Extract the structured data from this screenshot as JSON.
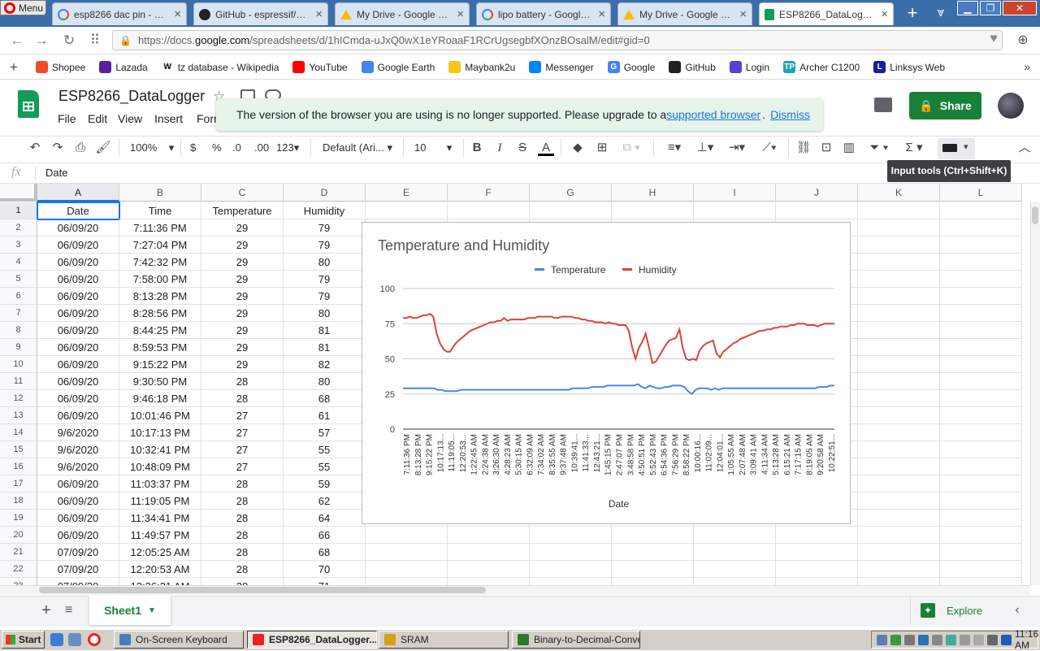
{
  "browser": {
    "menu_label": "Menu",
    "tabs": [
      {
        "title": "esp8266 dac pin - Google",
        "icon": "google-icon",
        "active": false
      },
      {
        "title": "GitHub - espressif/ESP82",
        "icon": "github-icon",
        "active": false
      },
      {
        "title": "My Drive - Google Drive",
        "icon": "drive-icon",
        "active": false
      },
      {
        "title": "lipo battery - Google Sea",
        "icon": "google-icon",
        "active": false
      },
      {
        "title": "My Drive - Google Drive",
        "icon": "drive-icon",
        "active": false
      },
      {
        "title": "ESP8266_DataLogger - G",
        "icon": "sheets-icon",
        "active": true
      }
    ],
    "url_prefix": "https://docs.",
    "url_host": "google.com",
    "url_path": "/spreadsheets/d/1hICmda-uJxQ0wX1eYRoaaF1RCrUgsegbfXOnzBOsalM/edit#gid=0",
    "bookmarks": [
      {
        "label": "Shopee",
        "color": "#ee4d2d"
      },
      {
        "label": "Lazada",
        "color": "#5a1f9e"
      },
      {
        "label": "tz database - Wikipedia",
        "color": "#ffffff",
        "glyph": "W"
      },
      {
        "label": "YouTube",
        "color": "#ff0000"
      },
      {
        "label": "Google Earth",
        "color": "#4285f4"
      },
      {
        "label": "Maybank2u",
        "color": "#f5c518"
      },
      {
        "label": "Messenger",
        "color": "#0084ff"
      },
      {
        "label": "Google",
        "color": "#4285f4",
        "glyph": "G"
      },
      {
        "label": "GitHub",
        "color": "#222222"
      },
      {
        "label": "Login",
        "color": "#5b3fd1"
      },
      {
        "label": "Archer C1200",
        "color": "#1aa3b8",
        "glyph": "TP"
      },
      {
        "label": "Linksys Web",
        "color": "#1a1aa8",
        "glyph": "L"
      }
    ]
  },
  "doc": {
    "title": "ESP8266_DataLogger",
    "menus": [
      "File",
      "Edit",
      "View",
      "Insert",
      "Forr"
    ],
    "banner_text": "The version of the browser you are using is no longer supported. Please upgrade to a",
    "banner_link": "supported browser",
    "banner_period": ".",
    "banner_dismiss": "Dismiss",
    "share_label": "Share"
  },
  "toolbar": {
    "zoom": "100%",
    "currency": "$",
    "percent": "%",
    "dec_less": ".0",
    "dec_more": ".00",
    "more_formats": "123",
    "font": "Default (Ari...",
    "font_size": "10",
    "bold": "B",
    "italic": "I",
    "strike": "S",
    "text_color": "A",
    "tooltip": "Input tools (Ctrl+Shift+K)"
  },
  "formula": {
    "fx": "fx",
    "value": "Date"
  },
  "grid": {
    "columns": [
      "A",
      "B",
      "C",
      "D",
      "E",
      "F",
      "G",
      "H",
      "I",
      "J",
      "K",
      "L"
    ],
    "row_numbers": [
      "1",
      "2",
      "3",
      "4",
      "5",
      "6",
      "7",
      "8",
      "9",
      "10",
      "11",
      "12",
      "13",
      "14",
      "15",
      "16",
      "17",
      "18",
      "19",
      "20",
      "21",
      "22",
      "23"
    ],
    "rows": [
      [
        "Date",
        "Time",
        "Temperature",
        "Humidity"
      ],
      [
        "06/09/20",
        "7:11:36 PM",
        "29",
        "79"
      ],
      [
        "06/09/20",
        "7:27:04 PM",
        "29",
        "79"
      ],
      [
        "06/09/20",
        "7:42:32 PM",
        "29",
        "80"
      ],
      [
        "06/09/20",
        "7:58:00 PM",
        "29",
        "79"
      ],
      [
        "06/09/20",
        "8:13:28 PM",
        "29",
        "79"
      ],
      [
        "06/09/20",
        "8:28:56 PM",
        "29",
        "80"
      ],
      [
        "06/09/20",
        "8:44:25 PM",
        "29",
        "81"
      ],
      [
        "06/09/20",
        "8:59:53 PM",
        "29",
        "81"
      ],
      [
        "06/09/20",
        "9:15:22 PM",
        "29",
        "82"
      ],
      [
        "06/09/20",
        "9:30:50 PM",
        "28",
        "80"
      ],
      [
        "06/09/20",
        "9:46:18 PM",
        "28",
        "68"
      ],
      [
        "06/09/20",
        "10:01:46 PM",
        "27",
        "61"
      ],
      [
        "9/6/2020",
        "10:17:13 PM",
        "27",
        "57"
      ],
      [
        "9/6/2020",
        "10:32:41 PM",
        "27",
        "55"
      ],
      [
        "9/6/2020",
        "10:48:09 PM",
        "27",
        "55"
      ],
      [
        "06/09/20",
        "11:03:37 PM",
        "28",
        "59"
      ],
      [
        "06/09/20",
        "11:19:05 PM",
        "28",
        "62"
      ],
      [
        "06/09/20",
        "11:34:41 PM",
        "28",
        "64"
      ],
      [
        "06/09/20",
        "11:49:57 PM",
        "28",
        "66"
      ],
      [
        "07/09/20",
        "12:05:25 AM",
        "28",
        "68"
      ],
      [
        "07/09/20",
        "12:20:53 AM",
        "28",
        "70"
      ],
      [
        "07/09/20",
        "12:36:21 AM",
        "28",
        "71"
      ]
    ]
  },
  "chart_data": {
    "type": "line",
    "title": "Temperature and Humidity",
    "xlabel": "Date",
    "ylabel": "",
    "ylim": [
      0,
      100
    ],
    "yticks": [
      "100",
      "75",
      "50",
      "25",
      "0"
    ],
    "legend_position": "top",
    "grid": true,
    "x_tick_labels": [
      "7:11:36 PM",
      "8:13:28 PM",
      "9:15:22 PM",
      "10:17:13...",
      "11:19:05...",
      "12:20:53...",
      "1:22:45 AM",
      "2:24:38 AM",
      "3:26:30 AM",
      "4:28:23 AM",
      "5:30:15 AM",
      "6:32:09 AM",
      "7:34:02 AM",
      "8:35:55 AM",
      "9:37:48 AM",
      "10:39:41...",
      "11:41:33...",
      "12:43:21...",
      "1:45:15 PM",
      "2:47:07 PM",
      "3:48:58 PM",
      "4:50:51 PM",
      "5:52:43 PM",
      "6:54:36 PM",
      "7:56:29 PM",
      "8:58:22 PM",
      "10:00:16...",
      "11:02:09...",
      "12:04:01...",
      "1:05:55 AM",
      "2:07:48 AM",
      "3:09:41 AM",
      "4:11:34 AM",
      "5:13:28 AM",
      "6:15:21 AM",
      "7:17:15 AM",
      "8:19:05 AM",
      "9:20:58 AM",
      "10:22:51..."
    ],
    "series": [
      {
        "name": "Temperature",
        "color": "#4a86e8",
        "values": [
          29,
          29,
          29,
          29,
          29,
          29,
          29,
          29,
          29,
          28,
          28,
          27,
          27,
          27,
          27,
          28,
          28,
          28,
          28,
          28,
          28,
          28,
          28,
          28,
          28,
          28,
          28,
          28,
          28,
          28,
          28,
          28,
          28,
          28,
          28,
          28,
          28,
          28,
          28,
          28,
          28,
          28,
          28,
          28,
          29,
          29,
          29,
          29,
          29,
          30,
          30,
          30,
          30,
          31,
          31,
          31,
          31,
          31,
          31,
          31,
          31,
          32,
          30,
          29,
          31,
          30,
          29,
          29,
          30,
          30,
          31,
          31,
          31,
          30,
          27,
          25,
          28,
          29,
          29,
          29,
          28,
          29,
          28,
          29,
          29,
          29,
          29,
          29,
          29,
          29,
          29,
          29,
          29,
          29,
          29,
          29,
          29,
          29,
          29,
          29,
          29,
          29,
          29,
          29,
          29,
          29,
          29,
          29,
          30,
          30,
          30,
          31,
          31
        ]
      },
      {
        "name": "Humidity",
        "color": "#db4437",
        "values": [
          79,
          79,
          80,
          79,
          79,
          80,
          81,
          81,
          82,
          80,
          68,
          61,
          57,
          55,
          55,
          59,
          62,
          64,
          66,
          68,
          70,
          71,
          72,
          73,
          74,
          75,
          76,
          76,
          77,
          77,
          79,
          77,
          78,
          78,
          78,
          78,
          78,
          79,
          79,
          79,
          80,
          80,
          80,
          80,
          80,
          79,
          79,
          80,
          80,
          80,
          80,
          79,
          79,
          78,
          78,
          77,
          77,
          76,
          76,
          76,
          75,
          76,
          75,
          75,
          74,
          74,
          74,
          70,
          58,
          50,
          58,
          62,
          68,
          58,
          47,
          48,
          52,
          56,
          60,
          63,
          64,
          65,
          71,
          58,
          50,
          49,
          50,
          49,
          56,
          59,
          61,
          62,
          63,
          54,
          51,
          55,
          57,
          59,
          61,
          62,
          64,
          65,
          66,
          67,
          68,
          69,
          70,
          70,
          71,
          71,
          72,
          72,
          73,
          73,
          73,
          74,
          74,
          75,
          75,
          75,
          74,
          74,
          74,
          73,
          74,
          75,
          75,
          75,
          75
        ]
      }
    ]
  },
  "sheetbar": {
    "sheet_name": "Sheet1",
    "explore": "Explore"
  },
  "taskbar": {
    "start": "Start",
    "tasks": [
      {
        "label": "On-Screen Keyboard",
        "active": false
      },
      {
        "label": "ESP8266_DataLogger...",
        "active": true
      },
      {
        "label": "SRAM",
        "active": false
      },
      {
        "label": "Binary-to-Decimal-Conve...",
        "active": false
      }
    ],
    "clock": "11:16 AM"
  }
}
